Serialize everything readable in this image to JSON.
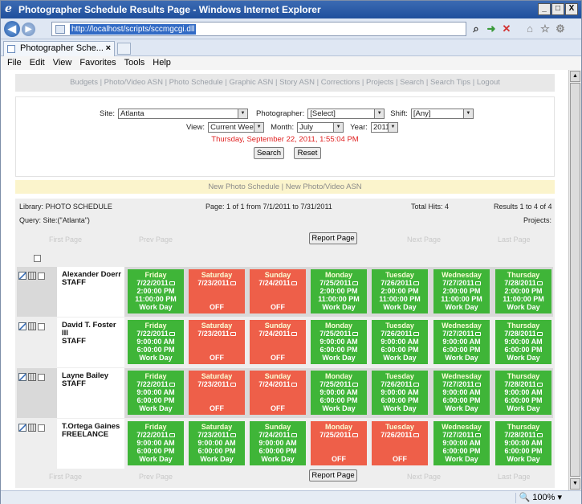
{
  "window": {
    "title": "Photographer Schedule Results Page - Windows Internet Explorer",
    "min": "_",
    "max": "□",
    "close": "X"
  },
  "browser": {
    "url": "http://localhost/scripts/sccmgcgi.dll",
    "tab_title": "Photographer Sche...",
    "tab_close": "×",
    "menu": [
      "File",
      "Edit",
      "View",
      "Favorites",
      "Tools",
      "Help"
    ],
    "zoom": "100%"
  },
  "topnav": "Budgets | Photo/Video ASN | Photo Schedule | Graphic ASN | Story ASN | Corrections | Projects | Search | Search Tips | Logout",
  "filters": {
    "site_label": "Site:",
    "site_value": "Atlanta",
    "photographer_label": "Photographer:",
    "photographer_value": "[Select]",
    "shift_label": "Shift:",
    "shift_value": "[Any]",
    "view_label": "View:",
    "view_value": "Current Week",
    "month_label": "Month:",
    "month_value": "July",
    "year_label": "Year:",
    "year_value": "2011",
    "datetime": "Thursday, September 22, 2011, 1:55:04 PM",
    "search_button": "Search",
    "reset_button": "Reset"
  },
  "newlinks": "New Photo Schedule | New Photo/Video ASN",
  "results": {
    "library": "Library: PHOTO SCHEDULE",
    "page": "Page: 1 of 1  from 7/1/2011 to 7/31/2011",
    "total": "Total Hits: 4",
    "range": "Results 1 to 4 of 4",
    "query": "Query: Site:(\"Atlanta\")",
    "projects": "Projects:",
    "first_page": "First Page",
    "prev_page": "Prev Page",
    "report_page": "Report Page",
    "next_page": "Next Page",
    "last_page": "Last Page"
  },
  "day_names": [
    "Friday",
    "Saturday",
    "Sunday",
    "Monday",
    "Tuesday",
    "Wednesday",
    "Thursday"
  ],
  "dates": [
    "7/22/2011",
    "7/23/2011",
    "7/24/2011",
    "7/25/2011",
    "7/26/2011",
    "7/27/2011",
    "7/28/2011"
  ],
  "rows": [
    {
      "name": "Alexander Doerr",
      "role": "STAFF",
      "days": [
        {
          "status": "work",
          "start": "2:00:00 PM",
          "end": "11:00:00 PM",
          "label": "Work Day"
        },
        {
          "status": "off",
          "label": "OFF"
        },
        {
          "status": "off",
          "label": "OFF"
        },
        {
          "status": "work",
          "start": "2:00:00 PM",
          "end": "11:00:00 PM",
          "label": "Work Day"
        },
        {
          "status": "work",
          "start": "2:00:00 PM",
          "end": "11:00:00 PM",
          "label": "Work Day"
        },
        {
          "status": "work",
          "start": "2:00:00 PM",
          "end": "11:00:00 PM",
          "label": "Work Day"
        },
        {
          "status": "work",
          "start": "2:00:00 PM",
          "end": "11:00:00 PM",
          "label": "Work Day"
        }
      ]
    },
    {
      "name": "David T. Foster III",
      "role": "STAFF",
      "days": [
        {
          "status": "work",
          "start": "9:00:00 AM",
          "end": "6:00:00 PM",
          "label": "Work Day"
        },
        {
          "status": "off",
          "label": "OFF"
        },
        {
          "status": "off",
          "label": "OFF"
        },
        {
          "status": "work",
          "start": "9:00:00 AM",
          "end": "6:00:00 PM",
          "label": "Work Day"
        },
        {
          "status": "work",
          "start": "9:00:00 AM",
          "end": "6:00:00 PM",
          "label": "Work Day"
        },
        {
          "status": "work",
          "start": "9:00:00 AM",
          "end": "6:00:00 PM",
          "label": "Work Day"
        },
        {
          "status": "work",
          "start": "9:00:00 AM",
          "end": "6:00:00 PM",
          "label": "Work Day"
        }
      ]
    },
    {
      "name": "Layne Bailey",
      "role": "STAFF",
      "days": [
        {
          "status": "work",
          "start": "9:00:00 AM",
          "end": "6:00:00 PM",
          "label": "Work Day"
        },
        {
          "status": "off",
          "label": "OFF"
        },
        {
          "status": "off",
          "label": "OFF"
        },
        {
          "status": "work",
          "start": "9:00:00 AM",
          "end": "6:00:00 PM",
          "label": "Work Day"
        },
        {
          "status": "work",
          "start": "9:00:00 AM",
          "end": "6:00:00 PM",
          "label": "Work Day"
        },
        {
          "status": "work",
          "start": "9:00:00 AM",
          "end": "6:00:00 PM",
          "label": "Work Day"
        },
        {
          "status": "work",
          "start": "9:00:00 AM",
          "end": "6:00:00 PM",
          "label": "Work Day"
        }
      ]
    },
    {
      "name": "T.Ortega Gaines",
      "role": "FREELANCE",
      "days": [
        {
          "status": "work",
          "start": "9:00:00 AM",
          "end": "6:00:00 PM",
          "label": "Work Day"
        },
        {
          "status": "work",
          "start": "9:00:00 AM",
          "end": "6:00:00 PM",
          "label": "Work Day"
        },
        {
          "status": "work",
          "start": "9:00:00 AM",
          "end": "6:00:00 PM",
          "label": "Work Day"
        },
        {
          "status": "off",
          "label": "OFF"
        },
        {
          "status": "off",
          "label": "OFF"
        },
        {
          "status": "work",
          "start": "9:00:00 AM",
          "end": "6:00:00 PM",
          "label": "Work Day"
        },
        {
          "status": "work",
          "start": "9:00:00 AM",
          "end": "6:00:00 PM",
          "label": "Work Day"
        }
      ]
    }
  ],
  "colors": {
    "work": "#3fb538",
    "off": "#ee5f49",
    "datetime": "#e02020"
  }
}
